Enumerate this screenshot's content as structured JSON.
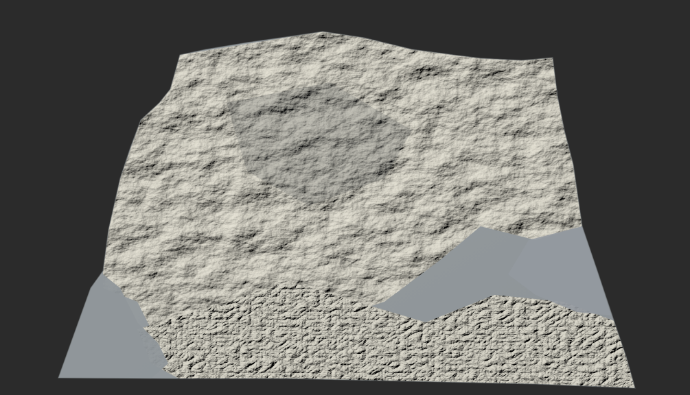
{
  "scene": {
    "background_color": "#2b2b2b",
    "subject": "terrain-relief-mesh",
    "colors": {
      "lowland": "#8a9196",
      "midtone": "#9ea2a3",
      "highlight": "#d4d2c6",
      "shadow": "#2e3236"
    }
  }
}
